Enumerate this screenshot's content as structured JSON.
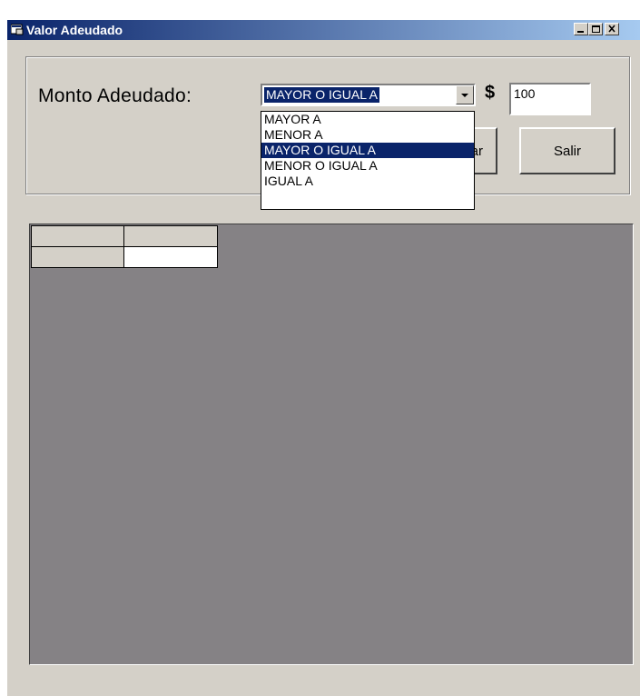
{
  "window": {
    "title": "Valor Adeudado",
    "icon": "app-icon",
    "buttons": [
      "minimize-icon",
      "maximize-icon",
      "close-icon"
    ]
  },
  "form": {
    "monto_label": "Monto Adeudado:",
    "combo_value": "MAYOR O IGUAL A",
    "combo_options": [
      "MAYOR A",
      "MENOR A",
      "MAYOR O IGUAL A",
      "MENOR O IGUAL A",
      "IGUAL A"
    ],
    "combo_selected_index": 2,
    "currency_symbol": "$",
    "amount_value": "100",
    "hidden_button_label_fragment": "ar",
    "salir_label": "Salir"
  },
  "grid": {
    "rows": [
      [
        "",
        ""
      ],
      [
        "",
        ""
      ]
    ]
  },
  "colors": {
    "title_start": "#0a246a",
    "title_end": "#a6caf0",
    "face": "#d4d0c8",
    "grid_bg": "#858285",
    "selection": "#0a246a"
  }
}
